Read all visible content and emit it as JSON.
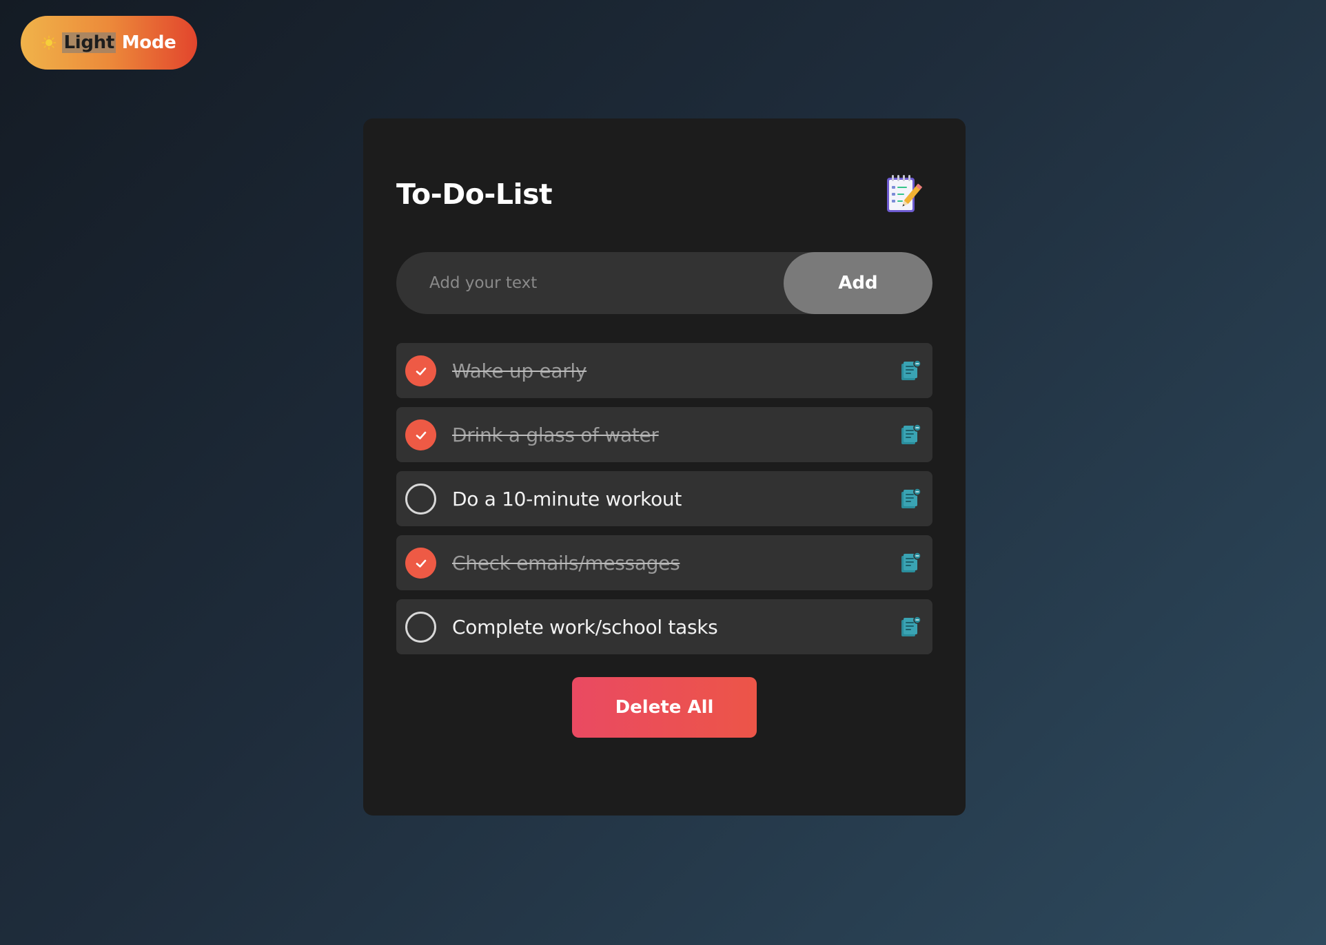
{
  "mode_toggle": {
    "icon": "sun-icon",
    "highlighted_word": "Light",
    "rest_word": " Mode"
  },
  "card": {
    "title": "To-Do-List",
    "title_icon": "notepad-icon"
  },
  "input": {
    "placeholder": "Add your text",
    "value": "",
    "add_label": "Add"
  },
  "tasks": [
    {
      "text": "Wake up early",
      "done": true
    },
    {
      "text": "Drink a glass of water",
      "done": true
    },
    {
      "text": "Do a 10-minute workout",
      "done": false
    },
    {
      "text": "Check emails/messages",
      "done": true
    },
    {
      "text": "Complete work/school tasks",
      "done": false
    }
  ],
  "delete_all_label": "Delete All",
  "colors": {
    "accent_done": "#ee5a45",
    "edit_icon": "#2a8d9c",
    "card_bg": "#1c1c1c",
    "item_bg": "#323232"
  }
}
